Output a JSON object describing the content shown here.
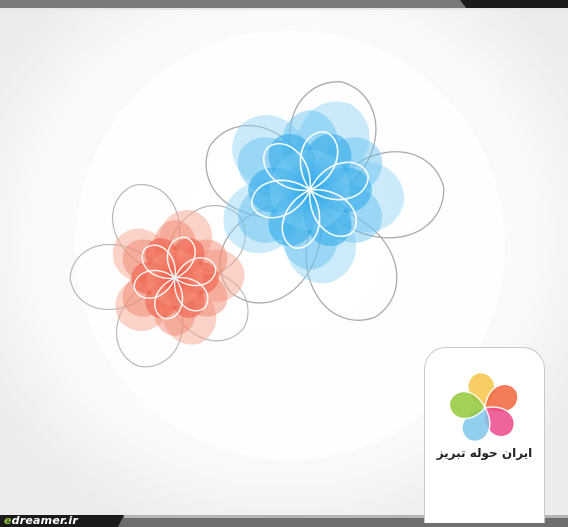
{
  "watermark": {
    "site": "edreamer.ir"
  },
  "logo": {
    "brand_name": "ایران حوله تبریز"
  },
  "colors": {
    "background": "#f4f4f4",
    "blue_flower": "#29a8e8",
    "red_flower": "#f0705a",
    "outline_gray": "#9a9a9a",
    "bar_dark": "#1a1a1a",
    "bar_gray": "#6e6e6e",
    "accent_green": "#8bc53f"
  },
  "logo_petal_colors": [
    "#f6c64a",
    "#f0643c",
    "#ec4b8c",
    "#7fc6ea",
    "#93c83a"
  ]
}
